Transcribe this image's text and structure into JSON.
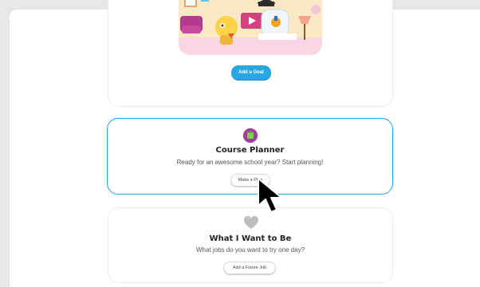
{
  "goal_card": {
    "button_label": "Add a Goal"
  },
  "course_card": {
    "title": "Course Planner",
    "subtitle": "Ready for an awesome school year? Start planning!",
    "button_label": "Make a Plan"
  },
  "job_card": {
    "title": "What I Want to Be",
    "subtitle": "What jobs do you want to try one day?",
    "button_label": "Add a Future Job"
  },
  "colors": {
    "accent_blue": "#2aa6e4",
    "course_border": "#1aa3dc",
    "course_badge": "#a23c9d",
    "heart_gray": "#bdbdbd"
  }
}
